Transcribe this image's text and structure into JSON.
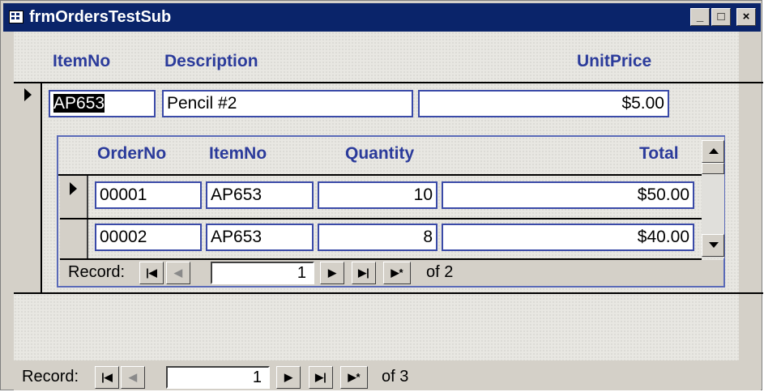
{
  "window": {
    "title": "frmOrdersTestSub",
    "icon": "form-icon",
    "controls": [
      "_",
      "□",
      "×"
    ]
  },
  "main_form": {
    "headers": {
      "item_no": "ItemNo",
      "description": "Description",
      "unit_price": "UnitPrice"
    },
    "record": {
      "item_no": "AP653",
      "description": "Pencil #2",
      "unit_price": "$5.00"
    },
    "navigation": {
      "label": "Record:",
      "current": "1",
      "of_text": "of 3"
    }
  },
  "subform": {
    "headers": {
      "order_no": "OrderNo",
      "item_no": "ItemNo",
      "quantity": "Quantity",
      "total": "Total"
    },
    "rows": [
      {
        "order_no": "00001",
        "item_no": "AP653",
        "quantity": "10",
        "total": "$50.00"
      },
      {
        "order_no": "00002",
        "item_no": "AP653",
        "quantity": "8",
        "total": "$40.00"
      }
    ],
    "navigation": {
      "label": "Record:",
      "current": "1",
      "of_text": "of 2"
    }
  },
  "nav_glyphs": {
    "first": "|◀",
    "prev": "◀",
    "next": "▶",
    "last": "▶|",
    "new": "▶*"
  }
}
